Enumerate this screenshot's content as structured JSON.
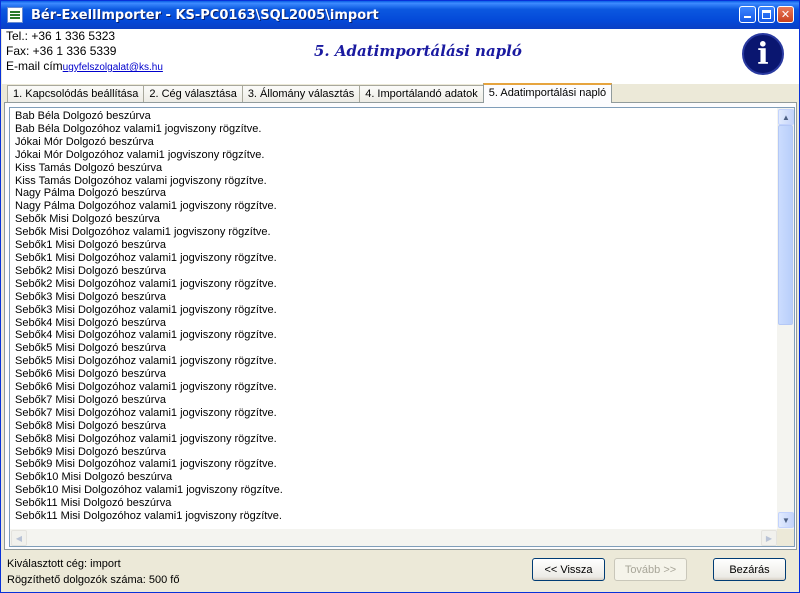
{
  "window": {
    "title": "Bér-ExellImporter - KS-PC0163\\SQL2005\\import"
  },
  "header": {
    "tel": "Tel.: +36 1 336 5323",
    "fax": "Fax: +36 1 336 5339",
    "email_label": "E-mail cím",
    "email_link": "ugyfelszolgalat@ks.hu",
    "page_title": "5. Adatimportálási napló",
    "info_icon_glyph": "i"
  },
  "tabs": [
    {
      "label": "1. Kapcsolódás beállítása",
      "active": false
    },
    {
      "label": "2. Cég választása",
      "active": false
    },
    {
      "label": "3. Állomány választás",
      "active": false
    },
    {
      "label": "4. Importálandó adatok",
      "active": false
    },
    {
      "label": "5. Adatimportálási napló",
      "active": true
    }
  ],
  "log": {
    "lines": [
      "Bab Béla Dolgozó beszúrva",
      "Bab Béla Dolgozóhoz  valami1 jogviszony rögzítve.",
      "Jókai Mór Dolgozó beszúrva",
      "Jókai Mór Dolgozóhoz  valami1 jogviszony rögzítve.",
      "Kiss Tamás Dolgozó beszúrva",
      "Kiss Tamás Dolgozóhoz  valami jogviszony rögzítve.",
      "Nagy Pálma Dolgozó beszúrva",
      "Nagy Pálma Dolgozóhoz  valami1 jogviszony rögzítve.",
      "Sebők Misi Dolgozó beszúrva",
      "Sebők Misi Dolgozóhoz  valami1 jogviszony rögzítve.",
      "Sebők1 Misi Dolgozó beszúrva",
      "Sebők1 Misi Dolgozóhoz  valami1 jogviszony rögzítve.",
      "Sebők2 Misi Dolgozó beszúrva",
      "Sebők2 Misi Dolgozóhoz  valami1 jogviszony rögzítve.",
      "Sebők3 Misi Dolgozó beszúrva",
      "Sebők3 Misi Dolgozóhoz  valami1 jogviszony rögzítve.",
      "Sebők4 Misi Dolgozó beszúrva",
      "Sebők4 Misi Dolgozóhoz  valami1 jogviszony rögzítve.",
      "Sebők5 Misi Dolgozó beszúrva",
      "Sebők5 Misi Dolgozóhoz  valami1 jogviszony rögzítve.",
      "Sebők6 Misi Dolgozó beszúrva",
      "Sebők6 Misi Dolgozóhoz  valami1 jogviszony rögzítve.",
      "Sebők7 Misi Dolgozó beszúrva",
      "Sebők7 Misi Dolgozóhoz  valami1 jogviszony rögzítve.",
      "Sebők8 Misi Dolgozó beszúrva",
      "Sebők8 Misi Dolgozóhoz  valami1 jogviszony rögzítve.",
      "Sebők9 Misi Dolgozó beszúrva",
      "Sebők9 Misi Dolgozóhoz  valami1 jogviszony rögzítve.",
      "Sebők10 Misi Dolgozó beszúrva",
      "Sebők10 Misi Dolgozóhoz  valami1 jogviszony rögzítve.",
      "Sebők11 Misi Dolgozó beszúrva",
      "Sebők11 Misi Dolgozóhoz  valami1 jogviszony rögzítve."
    ]
  },
  "status": {
    "selected_company": "Kiválasztott cég: import",
    "employee_count": "Rögzíthető dolgozók száma: 500 fő"
  },
  "buttons": {
    "back": "<< Vissza",
    "next": "Tovább >>",
    "close": "Bezárás"
  }
}
